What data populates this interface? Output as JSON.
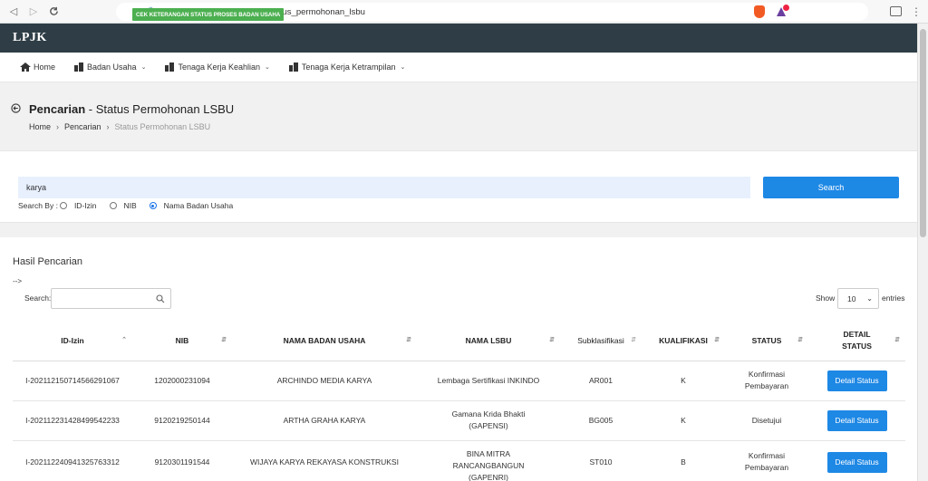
{
  "browser": {
    "url": "siki.pu.go.id/search/search_status_permohonan_lsbu"
  },
  "header": {
    "logo": "LPJK",
    "status_button": "CEK KETERANGAN STATUS PROSES BADAN USAHA"
  },
  "menu": {
    "items": [
      {
        "label": "Home",
        "dropdown": false
      },
      {
        "label": "Badan Usaha",
        "dropdown": true
      },
      {
        "label": "Tenaga Kerja Keahlian",
        "dropdown": true
      },
      {
        "label": "Tenaga Kerja Ketrampilan",
        "dropdown": true
      }
    ]
  },
  "page": {
    "title_bold": "Pencarian",
    "title_rest": " - Status Permohonan LSBU",
    "breadcrumb": [
      "Home",
      "Pencarian",
      "Status Permohonan LSBU"
    ]
  },
  "search": {
    "value": "karya",
    "button": "Search",
    "search_by_label": "Search By :",
    "options": [
      "ID-Izin",
      "NIB",
      "Nama Badan Usaha"
    ],
    "selected": "Nama Badan Usaha"
  },
  "results": {
    "title": "Hasil Pencarian",
    "arrow_text": "-->",
    "table_search_label": "Search:",
    "show_label": "Show",
    "show_value": "10",
    "entries_label": "entries",
    "columns": [
      "ID-Izin",
      "NIB",
      "NAMA BADAN USAHA",
      "NAMA LSBU",
      "Subklasifikasi",
      "KUALIFIKASI",
      "STATUS",
      "DETAIL STATUS"
    ],
    "rows": [
      {
        "id_izin": "I-202112150714566291067",
        "nib": "1202000231094",
        "nama_bu": "ARCHINDO MEDIA KARYA",
        "nama_lsbu": "Lembaga Sertifikasi INKINDO",
        "subklasifikasi": "AR001",
        "kualifikasi": "K",
        "status": "Konfirmasi Pembayaran",
        "button": "Detail Status"
      },
      {
        "id_izin": "I-202112231428499542233",
        "nib": "9120219250144",
        "nama_bu": "ARTHA GRAHA KARYA",
        "nama_lsbu": "Gamana Krida Bhakti (GAPENSI)",
        "subklasifikasi": "BG005",
        "kualifikasi": "K",
        "status": "Disetujui",
        "button": "Detail Status"
      },
      {
        "id_izin": "I-202112240941325763312",
        "nib": "9120301191544",
        "nama_bu": "WIJAYA KARYA REKAYASA KONSTRUKSI",
        "nama_lsbu": "BINA MITRA RANCANGBANGUN (GAPENRI)",
        "subklasifikasi": "ST010",
        "kualifikasi": "B",
        "status": "Konfirmasi Pembayaran",
        "button": "Detail Status"
      }
    ]
  }
}
